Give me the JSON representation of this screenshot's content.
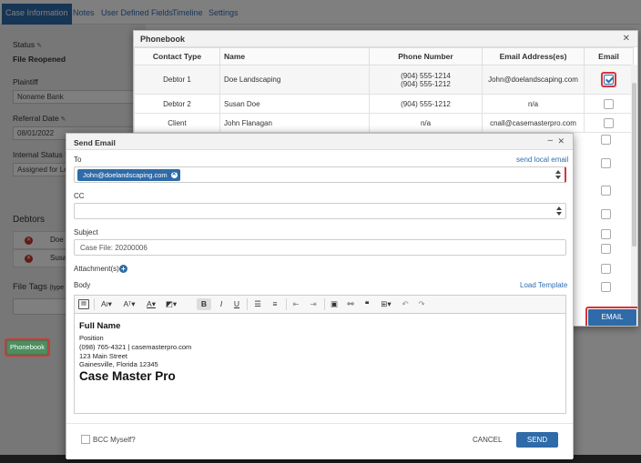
{
  "case": {
    "tabs": [
      "Case Information",
      "Notes",
      "User Defined Fields",
      "Timeline",
      "Settings"
    ],
    "status_label": "Status",
    "status_value": "File Reopened",
    "plaintiff_label": "Plaintiff",
    "plaintiff_value": "Noname Bank",
    "referral_date_label": "Referral Date",
    "referral_date_value": "08/01/2022",
    "internal_status_label": "Internal Status",
    "internal_status_value": "Assigned for Leg",
    "debtors_heading": "Debtors",
    "debtors": [
      "Doe",
      "Susa"
    ],
    "file_tags_label": "File Tags",
    "file_tags_hint": "(type a",
    "phonebook_button": "Phonebook"
  },
  "phonebook": {
    "title": "Phonebook",
    "columns": [
      "Contact Type",
      "Name",
      "Phone Number",
      "Email Address(es)",
      "Email"
    ],
    "rows": [
      {
        "type": "Debtor 1",
        "name": "Doe Landscaping",
        "phone1": "(904) 555-1214",
        "phone2": "(904) 555-1212",
        "email": "John@doelandscaping.com",
        "checked": true
      },
      {
        "type": "Debtor 2",
        "name": "Susan Doe",
        "phone1": "(904) 555-1212",
        "phone2": "",
        "email": "n/a",
        "checked": false
      },
      {
        "type": "Client",
        "name": "John Flanagan",
        "phone1": "n/a",
        "phone2": "",
        "email": "cnall@casemasterpro.com",
        "checked": false
      }
    ],
    "email_button": "EMAIL"
  },
  "send_email": {
    "title": "Send Email",
    "to_label": "To",
    "send_local_link": "send local email",
    "to_recipient": "John@doelandscaping.com",
    "cc_label": "CC",
    "subject_label": "Subject",
    "subject_value": "Case File: 20200006",
    "attachments_label": "Attachment(s):",
    "body_label": "Body",
    "load_template_link": "Load Template",
    "signature": {
      "name": "Full Name",
      "position": "Position",
      "contact": "(098) 765-4321 | casemasterpro.com",
      "street": "123 Main Street",
      "city": "Gainesville, Florida 12345",
      "company": "Case Master Pro"
    },
    "bcc_label": "BCC Myself?",
    "cancel_button": "CANCEL",
    "send_button": "SEND"
  },
  "colors": {
    "accent": "#2e6ba8",
    "highlight": "#d9343a",
    "phonebook_green": "#4c8e5f"
  }
}
